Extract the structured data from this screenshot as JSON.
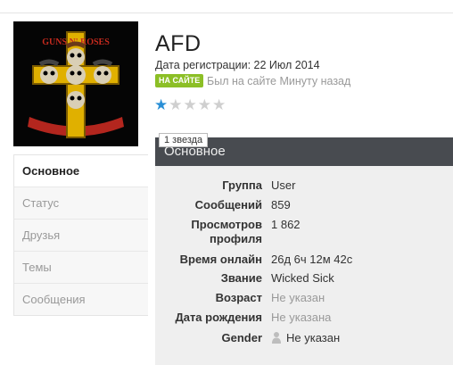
{
  "profile": {
    "name": "AFD",
    "registration": "Дата регистрации: 22 Июл 2014",
    "online_badge": "НА САЙТЕ",
    "last_seen": "Был на сайте Минуту назад",
    "rating": {
      "value": 1,
      "max": 5,
      "tooltip": "1 звезда"
    },
    "avatar_icon": "guns-n-roses-cross-logo"
  },
  "sidebar": {
    "items": [
      {
        "label": "Основное",
        "active": true
      },
      {
        "label": "Статус",
        "active": false
      },
      {
        "label": "Друзья",
        "active": false
      },
      {
        "label": "Темы",
        "active": false
      },
      {
        "label": "Сообщения",
        "active": false
      }
    ]
  },
  "section": {
    "title": "Основное"
  },
  "info": [
    {
      "label": "Группа",
      "value": "User"
    },
    {
      "label": "Сообщений",
      "value": "859"
    },
    {
      "label": "Просмотров профиля",
      "value": "1 862"
    },
    {
      "label": "Время онлайн",
      "value": "26д 6ч 12м 42с"
    },
    {
      "label": "Звание",
      "value": "Wicked Sick"
    },
    {
      "label": "Возраст",
      "value": "Не указан"
    },
    {
      "label": "Дата рождения",
      "value": "Не указана"
    },
    {
      "label": "Gender",
      "value": "Не указан"
    }
  ],
  "colors": {
    "accent": "#2a8fd6",
    "online": "#8cbf26",
    "header": "#484b50"
  }
}
